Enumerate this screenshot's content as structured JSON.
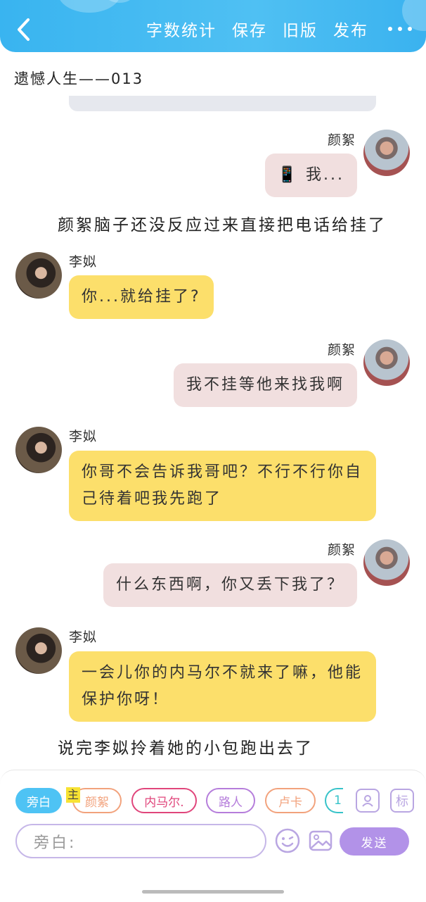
{
  "header": {
    "actions": [
      "字数统计",
      "保存",
      "旧版",
      "发布"
    ]
  },
  "title": "遗憾人生——013",
  "messages": [
    {
      "speaker": "颜絮",
      "text": "📱 我..."
    },
    {
      "narration": "颜絮脑子还没反应过来直接把电话给挂了"
    },
    {
      "speaker": "李姒",
      "text": "你...就给挂了?"
    },
    {
      "speaker": "颜絮",
      "text": "我不挂等他来找我啊"
    },
    {
      "speaker": "李姒",
      "text": "你哥不会告诉我哥吧？不行不行你自己待着吧我先跑了"
    },
    {
      "speaker": "颜絮",
      "text": "什么东西啊，你又丢下我了？"
    },
    {
      "speaker": "李姒",
      "text": "一会儿你的内马尔不就来了嘛，他能保护你呀！"
    },
    {
      "narration": "说完李姒拎着她的小包跑出去了"
    }
  ],
  "role_chips": [
    {
      "label": "旁白",
      "color": "#4ec3f4"
    },
    {
      "label": "颜絮",
      "color": "#f2a27c"
    },
    {
      "label": "内马尔.",
      "color": "#e0457b"
    },
    {
      "label": "路人",
      "color": "#b57ddb"
    },
    {
      "label": "卢卡",
      "color": "#f2a27c"
    },
    {
      "label": "1",
      "color": "#37c3c9"
    }
  ],
  "main_tag": "主",
  "tool_icons": {
    "character": "user-card-icon",
    "mark": "标"
  },
  "input": {
    "placeholder": "旁白:"
  },
  "send_label": "发送"
}
